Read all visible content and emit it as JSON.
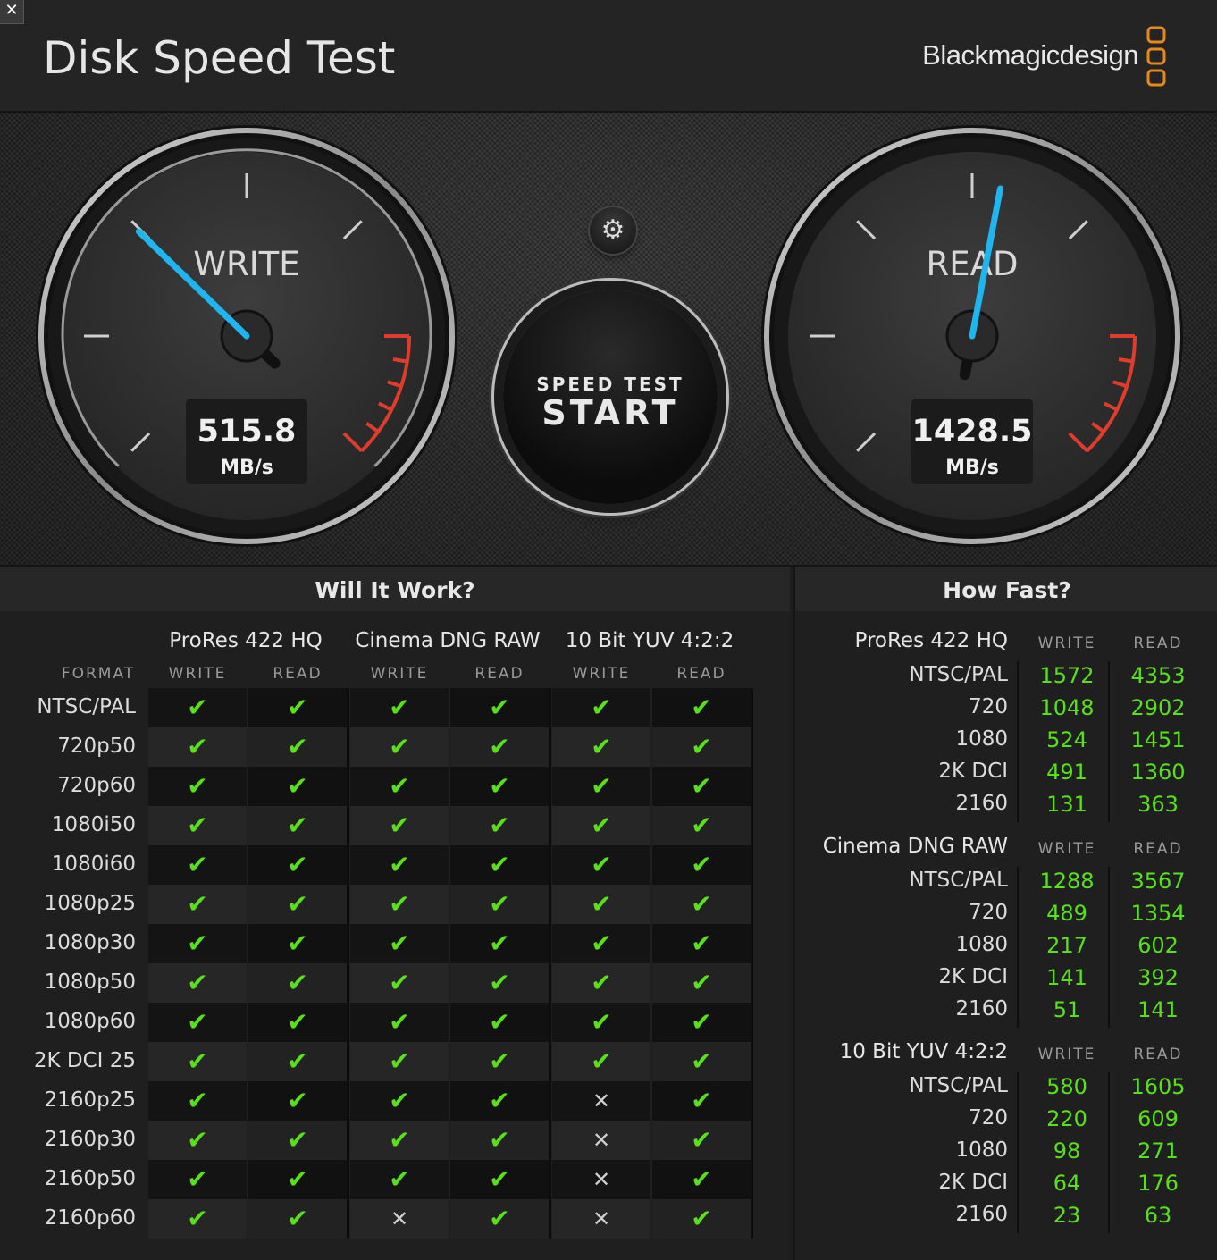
{
  "header": {
    "close_label": "✕",
    "title": "Disk Speed Test",
    "brand": "Blackmagicdesign"
  },
  "gauges": {
    "write": {
      "label": "WRITE",
      "value": "515.8",
      "unit": "MB/s",
      "needle_fraction": 0.33
    },
    "read": {
      "label": "READ",
      "value": "1428.5",
      "unit": "MB/s",
      "needle_fraction": 0.54
    }
  },
  "controls": {
    "settings_icon": "gear-icon",
    "start_sub": "SPEED TEST",
    "start_main": "START"
  },
  "colors": {
    "accent_blue": "#1fb6ef",
    "ok_green": "#58e01a",
    "redline": "#e03c2c",
    "brand_orange": "#e58a1a"
  },
  "will_it_work": {
    "title": "Will It Work?",
    "format_header": "FORMAT",
    "groups": [
      "ProRes 422 HQ",
      "Cinema DNG RAW",
      "10 Bit YUV 4:2:2"
    ],
    "sub_headers": [
      "WRITE",
      "READ",
      "WRITE",
      "READ",
      "WRITE",
      "READ"
    ],
    "rows": [
      {
        "format": "NTSC/PAL",
        "cells": [
          1,
          1,
          1,
          1,
          1,
          1
        ]
      },
      {
        "format": "720p50",
        "cells": [
          1,
          1,
          1,
          1,
          1,
          1
        ]
      },
      {
        "format": "720p60",
        "cells": [
          1,
          1,
          1,
          1,
          1,
          1
        ]
      },
      {
        "format": "1080i50",
        "cells": [
          1,
          1,
          1,
          1,
          1,
          1
        ]
      },
      {
        "format": "1080i60",
        "cells": [
          1,
          1,
          1,
          1,
          1,
          1
        ]
      },
      {
        "format": "1080p25",
        "cells": [
          1,
          1,
          1,
          1,
          1,
          1
        ]
      },
      {
        "format": "1080p30",
        "cells": [
          1,
          1,
          1,
          1,
          1,
          1
        ]
      },
      {
        "format": "1080p50",
        "cells": [
          1,
          1,
          1,
          1,
          1,
          1
        ]
      },
      {
        "format": "1080p60",
        "cells": [
          1,
          1,
          1,
          1,
          1,
          1
        ]
      },
      {
        "format": "2K DCI 25",
        "cells": [
          1,
          1,
          1,
          1,
          1,
          1
        ]
      },
      {
        "format": "2160p25",
        "cells": [
          1,
          1,
          1,
          1,
          0,
          1
        ]
      },
      {
        "format": "2160p30",
        "cells": [
          1,
          1,
          1,
          1,
          0,
          1
        ]
      },
      {
        "format": "2160p50",
        "cells": [
          1,
          1,
          1,
          1,
          0,
          1
        ]
      },
      {
        "format": "2160p60",
        "cells": [
          1,
          1,
          0,
          1,
          0,
          1
        ]
      }
    ],
    "check_glyph": "✔",
    "cross_glyph": "✕"
  },
  "how_fast": {
    "title": "How Fast?",
    "write_header": "WRITE",
    "read_header": "READ",
    "sections": [
      {
        "name": "ProRes 422 HQ",
        "rows": [
          {
            "label": "NTSC/PAL",
            "write": "1572",
            "read": "4353"
          },
          {
            "label": "720",
            "write": "1048",
            "read": "2902"
          },
          {
            "label": "1080",
            "write": "524",
            "read": "1451"
          },
          {
            "label": "2K DCI",
            "write": "491",
            "read": "1360"
          },
          {
            "label": "2160",
            "write": "131",
            "read": "363"
          }
        ]
      },
      {
        "name": "Cinema DNG RAW",
        "rows": [
          {
            "label": "NTSC/PAL",
            "write": "1288",
            "read": "3567"
          },
          {
            "label": "720",
            "write": "489",
            "read": "1354"
          },
          {
            "label": "1080",
            "write": "217",
            "read": "602"
          },
          {
            "label": "2K DCI",
            "write": "141",
            "read": "392"
          },
          {
            "label": "2160",
            "write": "51",
            "read": "141"
          }
        ]
      },
      {
        "name": "10 Bit YUV 4:2:2",
        "rows": [
          {
            "label": "NTSC/PAL",
            "write": "580",
            "read": "1605"
          },
          {
            "label": "720",
            "write": "220",
            "read": "609"
          },
          {
            "label": "1080",
            "write": "98",
            "read": "271"
          },
          {
            "label": "2K DCI",
            "write": "64",
            "read": "176"
          },
          {
            "label": "2160",
            "write": "23",
            "read": "63"
          }
        ]
      }
    ]
  }
}
